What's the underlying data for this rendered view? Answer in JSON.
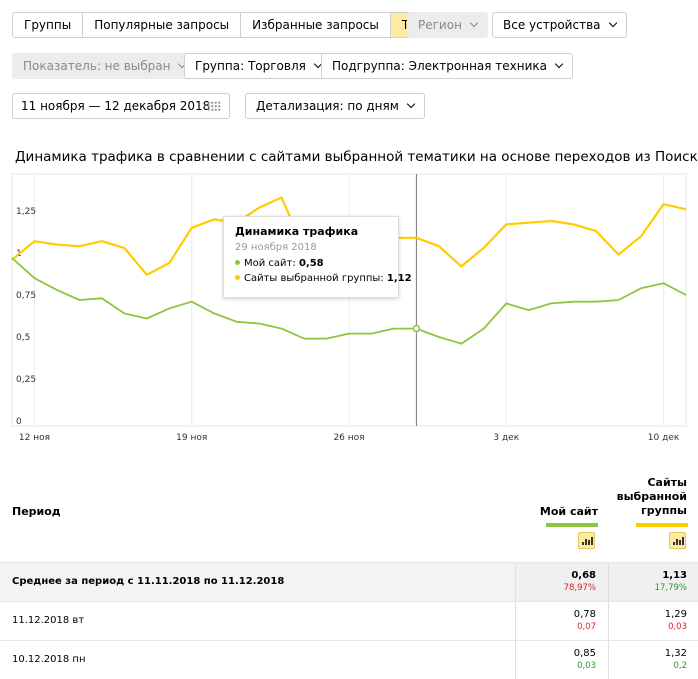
{
  "tabs": [
    {
      "label": "Группы",
      "active": false
    },
    {
      "label": "Популярные запросы",
      "active": false
    },
    {
      "label": "Избранные запросы",
      "active": false
    },
    {
      "label": "Тренд",
      "active": true
    }
  ],
  "filters": {
    "region": "Регион",
    "devices": "Все устройства",
    "metric": "Показатель: не выбран",
    "group": "Группа: Торговля",
    "subgroup": "Подгруппа: Электронная техника",
    "date_range": "11 ноября — 12 декабря 2018",
    "detail": "Детализация: по дням"
  },
  "chart_title": "Динамика трафика в сравнении с сайтами выбранной тематики на основе переходов из Поиска",
  "info_icon": "i",
  "colors": {
    "my_site": "#8cc63f",
    "group_sites": "#ffcc00",
    "accent": "#ffeba0"
  },
  "chart_data": {
    "type": "line",
    "x": [
      "11.11",
      "12.11",
      "13.11",
      "14.11",
      "15.11",
      "16.11",
      "17.11",
      "18.11",
      "19.11",
      "20.11",
      "21.11",
      "22.11",
      "23.11",
      "24.11",
      "25.11",
      "26.11",
      "27.11",
      "28.11",
      "29.11",
      "30.11",
      "01.12",
      "02.12",
      "03.12",
      "04.12",
      "05.12",
      "06.12",
      "07.12",
      "08.12",
      "09.12",
      "10.12",
      "11.12"
    ],
    "x_ticks": [
      {
        "index": 1,
        "label": "12 ноя"
      },
      {
        "index": 8,
        "label": "19 ноя"
      },
      {
        "index": 15,
        "label": "26 ноя"
      },
      {
        "index": 22,
        "label": "3 дек"
      },
      {
        "index": 29,
        "label": "10 дек"
      }
    ],
    "y_ticks": [
      {
        "value": 0,
        "label": "0"
      },
      {
        "value": 0.25,
        "label": "0,25"
      },
      {
        "value": 0.5,
        "label": "0,5"
      },
      {
        "value": 0.75,
        "label": "0,75"
      },
      {
        "value": 1,
        "label": "1"
      },
      {
        "value": 1.25,
        "label": "1,25"
      }
    ],
    "ylim": [
      0,
      1.5
    ],
    "series": [
      {
        "name": "Мой сайт",
        "color": "#8cc63f",
        "values": [
          1.0,
          0.88,
          0.81,
          0.75,
          0.76,
          0.67,
          0.64,
          0.7,
          0.74,
          0.67,
          0.62,
          0.61,
          0.58,
          0.52,
          0.52,
          0.55,
          0.55,
          0.58,
          0.58,
          0.53,
          0.49,
          0.58,
          0.73,
          0.69,
          0.73,
          0.74,
          0.74,
          0.75,
          0.82,
          0.85,
          0.78
        ]
      },
      {
        "name": "Сайты выбранной группы",
        "color": "#ffcc00",
        "values": [
          0.99,
          1.1,
          1.08,
          1.07,
          1.1,
          1.06,
          0.9,
          0.97,
          1.18,
          1.23,
          1.21,
          1.3,
          1.36,
          1.05,
          1.1,
          1.15,
          1.13,
          1.12,
          1.12,
          1.07,
          0.95,
          1.06,
          1.2,
          1.21,
          1.22,
          1.2,
          1.16,
          1.02,
          1.13,
          1.32,
          1.29
        ]
      }
    ],
    "hover_index": 18
  },
  "tooltip": {
    "title": "Динамика трафика",
    "date": "29 ноября 2018",
    "my_label": "Мой сайт:",
    "my_value": "0,58",
    "group_label": "Сайты выбранной группы:",
    "group_value": "1,12"
  },
  "table": {
    "period_header": "Период",
    "col1": "Мой сайт",
    "col2_line1": "Сайты",
    "col2_line2": "выбранной",
    "col2_line3": "группы",
    "rows": [
      {
        "label": "Среднее за период с 11.11.2018 по 11.12.2018",
        "v1": "0,68",
        "d1": "78,97%",
        "d1_color": "#e02020",
        "v2": "1,13",
        "d2": "17,79%",
        "d2_color": "#2a9a2a",
        "bold": true
      },
      {
        "label": "11.12.2018 вт",
        "v1": "0,78",
        "d1": "0,07",
        "d1_color": "#e02020",
        "v2": "1,29",
        "d2": "0,03",
        "d2_color": "#e02020",
        "bold": false
      },
      {
        "label": "10.12.2018 пн",
        "v1": "0,85",
        "d1": "0,03",
        "d1_color": "#2a9a2a",
        "v2": "1,32",
        "d2": "0,2",
        "d2_color": "#2a9a2a",
        "bold": false
      }
    ]
  }
}
